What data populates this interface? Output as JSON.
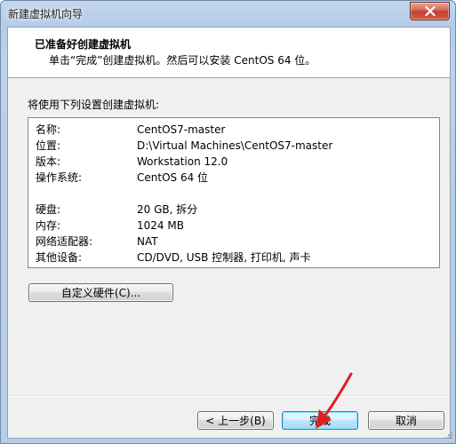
{
  "window": {
    "title": "新建虚拟机向导"
  },
  "header": {
    "title": "已准备好创建虚拟机",
    "subtitle": "单击“完成”创建虚拟机。然后可以安装 CentOS 64 位。"
  },
  "content": {
    "intro": "将使用下列设置创建虚拟机:",
    "rows": [
      {
        "label": "名称:",
        "value": "CentOS7-master"
      },
      {
        "label": "位置:",
        "value": "D:\\Virtual Machines\\CentOS7-master"
      },
      {
        "label": "版本:",
        "value": "Workstation 12.0"
      },
      {
        "label": "操作系统:",
        "value": "CentOS 64 位"
      },
      {
        "label": "硬盘:",
        "value": "20 GB, 拆分"
      },
      {
        "label": "内存:",
        "value": "1024 MB"
      },
      {
        "label": "网络适配器:",
        "value": "NAT"
      },
      {
        "label": "其他设备:",
        "value": "CD/DVD, USB 控制器, 打印机, 声卡"
      }
    ]
  },
  "buttons": {
    "customize": "自定义硬件(C)...",
    "back": "< 上一步(B)",
    "finish": "完成",
    "cancel": "取消"
  },
  "colors": {
    "arrow": "#e02020"
  }
}
